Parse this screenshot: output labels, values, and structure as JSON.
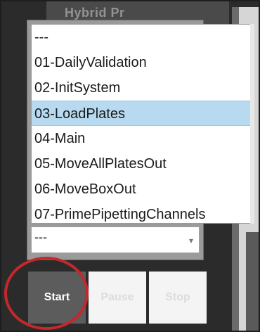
{
  "header": {
    "title": "Hybrid Pr"
  },
  "dropdown": {
    "options": [
      "---",
      "01-DailyValidation",
      "02-InitSystem",
      "03-LoadPlates",
      "04-Main",
      "05-MoveAllPlatesOut",
      "06-MoveBoxOut",
      "07-PrimePipettingChannels"
    ],
    "selected": "03-LoadPlates"
  },
  "combo": {
    "value": "---"
  },
  "buttons": {
    "start": "Start",
    "pause": "Pause",
    "stop": "Stop"
  }
}
